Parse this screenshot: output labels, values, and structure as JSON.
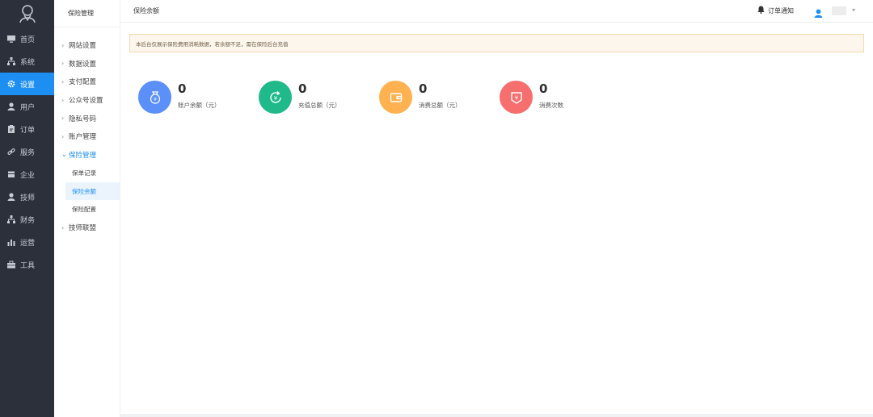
{
  "nav": {
    "items": [
      {
        "label": "首页",
        "icon": "monitor-icon"
      },
      {
        "label": "系统",
        "icon": "sitemap-icon"
      },
      {
        "label": "设置",
        "icon": "gear-icon",
        "active": true
      },
      {
        "label": "用户",
        "icon": "user-icon"
      },
      {
        "label": "订单",
        "icon": "clipboard-icon"
      },
      {
        "label": "服务",
        "icon": "link-icon"
      },
      {
        "label": "企业",
        "icon": "building-icon"
      },
      {
        "label": "技师",
        "icon": "person-icon"
      },
      {
        "label": "财务",
        "icon": "sitemap-icon"
      },
      {
        "label": "运营",
        "icon": "bars-icon"
      },
      {
        "label": "工具",
        "icon": "toolbox-icon"
      }
    ]
  },
  "submenu": {
    "title": "保险管理",
    "items": [
      {
        "label": "网站设置"
      },
      {
        "label": "数据设置"
      },
      {
        "label": "支付配置"
      },
      {
        "label": "公众号设置"
      },
      {
        "label": "隐私号码"
      },
      {
        "label": "账户管理"
      },
      {
        "label": "保险管理",
        "open": true,
        "children": [
          {
            "label": "保单记录"
          },
          {
            "label": "保险余额",
            "active": true
          },
          {
            "label": "保险配置"
          }
        ]
      },
      {
        "label": "技师联盟"
      }
    ]
  },
  "header": {
    "breadcrumb": "保险余额",
    "notice": "订单通知"
  },
  "alert": {
    "text": "本后台仅展示保险费用消耗数据，若余额不足，需在保险后台充值"
  },
  "stats": [
    {
      "value": "0",
      "label": "账户余额（元）",
      "color": "#5b8ff9",
      "icon": "money-bag-icon"
    },
    {
      "value": "0",
      "label": "充值总额（元）",
      "color": "#1fb98a",
      "icon": "recharge-icon"
    },
    {
      "value": "0",
      "label": "消费总额（元）",
      "color": "#ffb24f",
      "icon": "wallet-icon"
    },
    {
      "value": "0",
      "label": "消费次数",
      "color": "#f76e6e",
      "icon": "receipt-icon"
    }
  ],
  "colors": {
    "nav_bg": "#2b303b",
    "accent": "#1e8ff2"
  }
}
